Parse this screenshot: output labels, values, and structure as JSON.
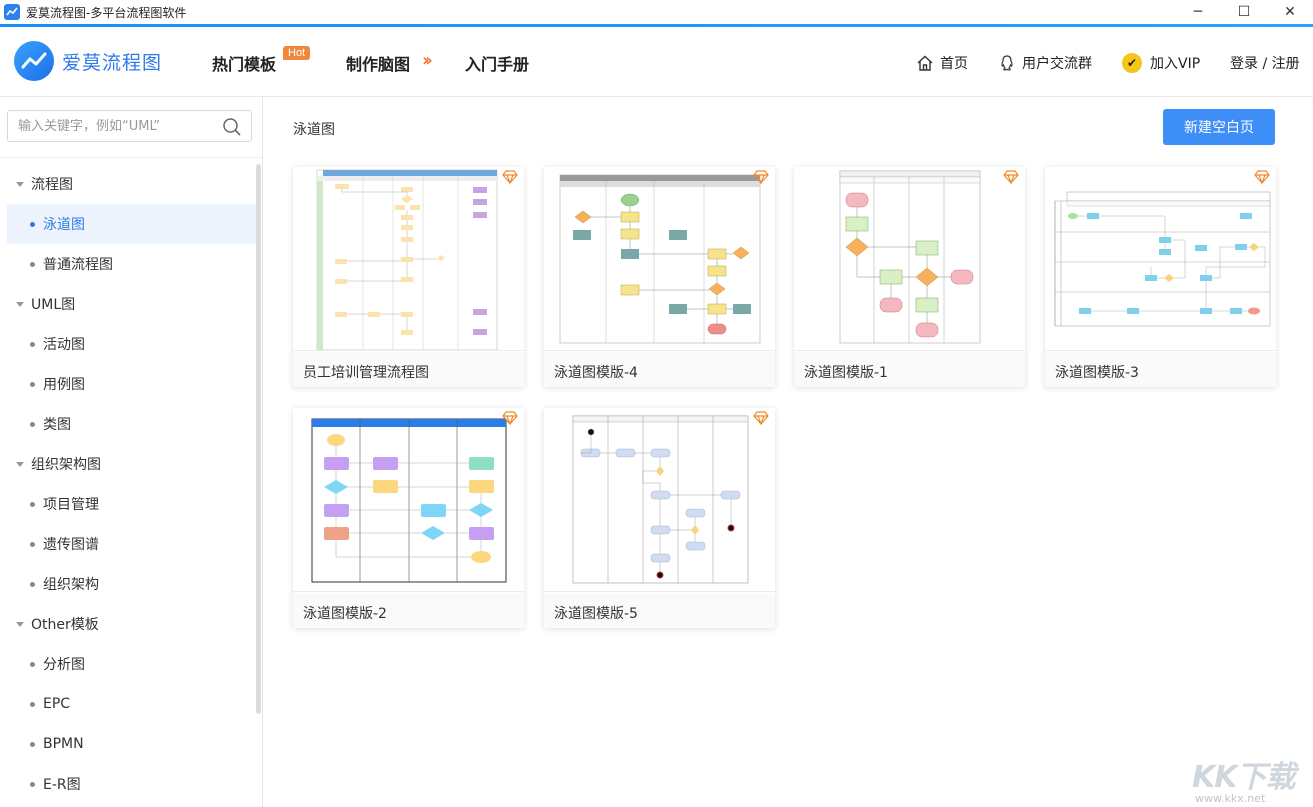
{
  "window": {
    "title": "爱莫流程图-多平台流程图软件",
    "minimize": "─",
    "maximize": "☐",
    "close": "✕"
  },
  "brand": {
    "name": "爱莫流程图"
  },
  "nav": {
    "hot_templates": "热门模板",
    "hot_badge": "Hot",
    "mindmap": "制作脑图",
    "manual": "入门手册",
    "home": "首页",
    "user_group": "用户交流群",
    "vip": "加入VIP",
    "login": "登录 / 注册"
  },
  "sidebar": {
    "search_placeholder": "输入关键字，例如“UML”",
    "tree": [
      {
        "type": "group",
        "label": "流程图"
      },
      {
        "type": "child",
        "label": "泳道图",
        "active": true
      },
      {
        "type": "child",
        "label": "普通流程图"
      },
      {
        "type": "group",
        "label": "UML图"
      },
      {
        "type": "child",
        "label": "活动图"
      },
      {
        "type": "child",
        "label": "用例图"
      },
      {
        "type": "child",
        "label": "类图"
      },
      {
        "type": "group",
        "label": "组织架构图"
      },
      {
        "type": "child",
        "label": "项目管理"
      },
      {
        "type": "child",
        "label": "遗传图谱"
      },
      {
        "type": "child",
        "label": "组织架构"
      },
      {
        "type": "group",
        "label": "Other模板"
      },
      {
        "type": "child",
        "label": "分析图"
      },
      {
        "type": "child",
        "label": "EPC"
      },
      {
        "type": "child",
        "label": "BPMN"
      },
      {
        "type": "child",
        "label": "E-R图"
      }
    ]
  },
  "main": {
    "title": "泳道图",
    "new_button": "新建空白页",
    "cards": [
      {
        "label": "员工培训管理流程图"
      },
      {
        "label": "泳道图模版-4"
      },
      {
        "label": "泳道图模版-1"
      },
      {
        "label": "泳道图模版-3"
      },
      {
        "label": "泳道图模版-2"
      },
      {
        "label": "泳道图模版-5"
      }
    ]
  },
  "watermark": {
    "text": "KK下载",
    "url": "www.kkx.net"
  },
  "colors": {
    "accent": "#2f7be8",
    "button": "#3e8ef7",
    "hot": "#f0883c",
    "vip": "#f5c518"
  }
}
